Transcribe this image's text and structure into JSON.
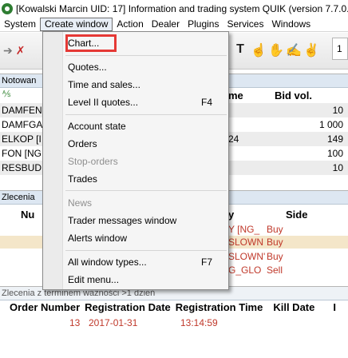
{
  "window": {
    "title": "[Kowalski Marcin UID: 17] Information and trading system QUIK (version 7.7.0."
  },
  "menubar": {
    "items": [
      "System",
      "Create window",
      "Action",
      "Dealer",
      "Plugins",
      "Services",
      "Windows"
    ]
  },
  "toolbar": {
    "right_value": "1",
    "icons": [
      "arrow-right-icon",
      "cancel-order-icon",
      "text-tool-icon",
      "hand-icon",
      "hand-stop-icon",
      "hand-edit-icon",
      "hand-ok-icon"
    ]
  },
  "quotes_panel": {
    "title": "Notowan",
    "headers": {
      "name_partial": "me",
      "bid_vol": "Bid vol."
    },
    "rows": [
      {
        "symbol": "DAMFEN",
        "mid": "",
        "bid_vol": "10"
      },
      {
        "symbol": "DAMFGA",
        "mid": "",
        "bid_vol": "1 000"
      },
      {
        "symbol": "ELKOP [I",
        "mid": "24",
        "bid_vol": "149"
      },
      {
        "symbol": "FON [NG",
        "mid": "",
        "bid_vol": "100"
      },
      {
        "symbol": "RESBUD",
        "mid": "",
        "bid_vol": "10"
      }
    ]
  },
  "orders_panel": {
    "title": "Zlecenia",
    "headers": {
      "num_partial": "Nu",
      "acct_partial": "y",
      "side": "Side"
    },
    "rows": [
      {
        "acct": "Y [NG_",
        "side": "Buy"
      },
      {
        "acct": "SLOWN",
        "side": "Buy"
      },
      {
        "acct": "SLOWN'",
        "side": "Buy"
      },
      {
        "acct": "G_GLO",
        "side": "Sell"
      }
    ]
  },
  "dated_orders_panel": {
    "title": "Zlecenia z terminem ważności >1 dzień",
    "headers": [
      "Order Number",
      "Registration Date",
      "Registration Time",
      "Kill Date",
      "I"
    ],
    "rows": [
      {
        "order_number": "13",
        "registration_date": "2017-01-31",
        "registration_time": "13:14:59"
      }
    ]
  },
  "create_window_menu": {
    "items": [
      {
        "label": "Chart...",
        "shortcut": "",
        "disabled": false
      },
      {
        "label": "Quotes...",
        "shortcut": "",
        "disabled": false
      },
      {
        "label": "Time and sales...",
        "shortcut": "",
        "disabled": false
      },
      {
        "label": "Level II quotes...",
        "shortcut": "F4",
        "disabled": false
      },
      {
        "label": "Account state",
        "shortcut": "",
        "disabled": false
      },
      {
        "label": "Orders",
        "shortcut": "",
        "disabled": false
      },
      {
        "label": "Stop-orders",
        "shortcut": "",
        "disabled": true
      },
      {
        "label": "Trades",
        "shortcut": "",
        "disabled": false
      },
      {
        "label": "News",
        "shortcut": "",
        "disabled": true
      },
      {
        "label": "Trader messages window",
        "shortcut": "",
        "disabled": false
      },
      {
        "label": "Alerts window",
        "shortcut": "",
        "disabled": false
      },
      {
        "label": "All window types...",
        "shortcut": "F7",
        "disabled": false
      },
      {
        "label": "Edit menu...",
        "shortcut": "",
        "disabled": false
      }
    ],
    "highlight_color": "#e53935"
  }
}
